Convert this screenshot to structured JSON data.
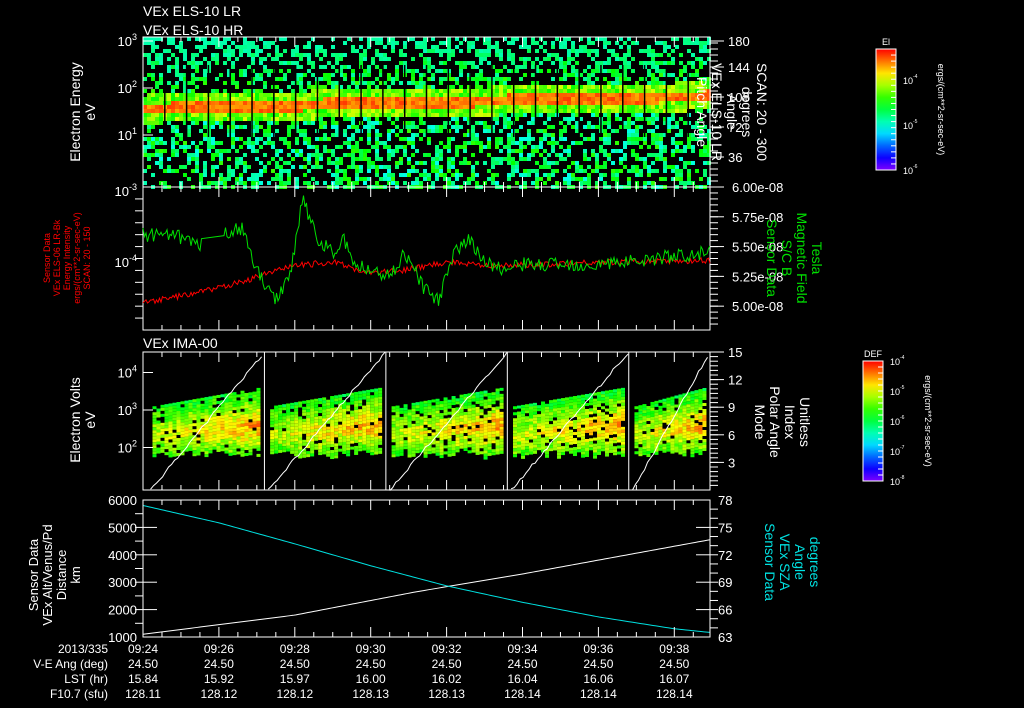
{
  "titles": {
    "p1_line1": "VEx ELS-10 LR",
    "p1_line2": "VEx ELS-10 HR",
    "p3": "VEx IMA-00"
  },
  "colors": {
    "background": "#000000",
    "axis": "#ffffff",
    "green": "#00e000",
    "red": "#ff0000",
    "cyan": "#00e0e0",
    "white": "#ffffff"
  },
  "chart_data": [
    {
      "type": "heatmap",
      "name": "ELS pitch-angle spectrogram",
      "ylabel": [
        "Electron Energy",
        "eV"
      ],
      "ylog": true,
      "ylim": [
        0.8,
        1000
      ],
      "yticks": [
        {
          "v": 1,
          "label": "10",
          "exp": "1"
        },
        {
          "v": 2,
          "label": "10",
          "exp": "2"
        },
        {
          "v": 3,
          "label": "10",
          "exp": "3"
        }
      ],
      "right_axis": {
        "label": [
          "Pitch Angle",
          "VEx ELS-10 LR",
          "Angle",
          "degrees",
          "SCAN: 20 - 300"
        ],
        "ticks": [
          "36",
          "72",
          "108",
          "144",
          "180"
        ],
        "ylim": [
          0,
          180
        ]
      },
      "scan_columns": 26,
      "peak_log_energy_by_minute": {
        "t": [
          0,
          3,
          6,
          9,
          12,
          15
        ],
        "v": [
          1.55,
          1.6,
          1.68,
          1.72,
          1.78,
          1.82
        ]
      },
      "colorbar": {
        "title": "El",
        "ticks": [
          {
            "label": "10",
            "exp": "-4"
          },
          {
            "label": "10",
            "exp": "-5"
          },
          {
            "label": "10",
            "exp": "-6"
          }
        ],
        "units": "ergs/(cm**2-sr-sec-eV)"
      }
    },
    {
      "type": "line",
      "name": "Energy intensity and magnetic field",
      "left_axis": {
        "label": [
          "Sensor Data",
          "VEx ELS-06 LR-Bk",
          "Energy Intensity",
          "ergs/(cm**2-sr-sec-eV)",
          "SCAN: 20 - 150"
        ],
        "ticks": [
          {
            "label": "10",
            "exp": "-3"
          },
          {
            "label": "10",
            "exp": "-4"
          }
        ],
        "ylim_log": [
          -4.9,
          -3
        ]
      },
      "right_axis": {
        "label": [
          "Sensor Data",
          "S/C B",
          "Magnetic Field",
          "Tesla"
        ],
        "ticks": [
          "5.00e-08",
          "5.25e-08",
          "5.50e-08",
          "5.75e-08",
          "6.00e-08"
        ],
        "ylim": [
          4.8e-08,
          6e-08
        ]
      },
      "series": [
        {
          "name": "Energy Intensity",
          "color": "#ff0000",
          "t_min": [
            0,
            1,
            2,
            3,
            4,
            5,
            6,
            7,
            8,
            9.5,
            12,
            14.94
          ],
          "log10_value": [
            -4.55,
            -4.45,
            -4.35,
            -4.2,
            -4.05,
            -4.0,
            -4.15,
            -4.1,
            -4.0,
            -4.05,
            -4.0,
            -3.98
          ]
        },
        {
          "name": "Magnetic Field",
          "color": "#00e000",
          "t_min": [
            0,
            1,
            1.5,
            2.2,
            2.6,
            3,
            3.5,
            3.9,
            4.2,
            4.6,
            5,
            5.3,
            5.6,
            6,
            6.5,
            6.9,
            7.4,
            7.8,
            8.2,
            8.6,
            9,
            9.5,
            10,
            12,
            14.94
          ],
          "value": [
            5.6e-08,
            5.58e-08,
            5.5e-08,
            5.62e-08,
            5.65e-08,
            5.3e-08,
            5.05e-08,
            5.3e-08,
            5.92e-08,
            5.55e-08,
            5.45e-08,
            5.55e-08,
            5.35e-08,
            5.3e-08,
            5.25e-08,
            5.45e-08,
            5.15e-08,
            5.05e-08,
            5.45e-08,
            5.55e-08,
            5.38e-08,
            5.3e-08,
            5.35e-08,
            5.35e-08,
            5.45e-08
          ]
        }
      ]
    },
    {
      "type": "heatmap",
      "name": "IMA ion spectrogram",
      "ylabel": [
        "Electron Volts",
        "eV"
      ],
      "ylog": true,
      "yticks": [
        {
          "v": 2,
          "label": "10",
          "exp": "2"
        },
        {
          "v": 3,
          "label": "10",
          "exp": "3"
        },
        {
          "v": 4,
          "label": "10",
          "exp": "4"
        }
      ],
      "right_axis": {
        "label": [
          "Mode",
          "Polar Angle",
          "Index",
          "Unitless"
        ],
        "ticks": [
          "3",
          "6",
          "9",
          "12",
          "15"
        ],
        "ylim": [
          0,
          15
        ]
      },
      "mode_change_minutes": [
        3.2,
        6.4,
        9.6,
        12.8
      ],
      "colorbar": {
        "title": "DEF",
        "ticks": [
          {
            "label": "10",
            "exp": "-4"
          },
          {
            "label": "10",
            "exp": "-5"
          },
          {
            "label": "10",
            "exp": "-6"
          },
          {
            "label": "10",
            "exp": "-7"
          },
          {
            "label": "10",
            "exp": "-8"
          }
        ],
        "units": "ergs/(cm**2-sr-sec-eV)"
      }
    },
    {
      "type": "line",
      "name": "Altitude and SZA",
      "left_axis": {
        "label": [
          "Sensor Data",
          "VEx Alt/Venus/Pd",
          "Distance",
          "km"
        ],
        "ticks": [
          "1000",
          "2000",
          "3000",
          "4000",
          "5000",
          "6000"
        ],
        "ylim": [
          1000,
          6000
        ]
      },
      "right_axis": {
        "label": [
          "Sensor Data",
          "VEx SZA",
          "Angle",
          "degrees"
        ],
        "ticks": [
          "63",
          "66",
          "69",
          "72",
          "75",
          "78"
        ],
        "ylim": [
          63,
          78
        ]
      },
      "series": [
        {
          "name": "Distance",
          "color": "#ffffff",
          "t_min": [
            0,
            4,
            7.2,
            10,
            14.94
          ],
          "value": [
            1100,
            1800,
            2650,
            3300,
            4550
          ]
        },
        {
          "name": "SZA",
          "color": "#00e0e0",
          "t_min": [
            0,
            2,
            4,
            6,
            8,
            10,
            12,
            14,
            14.94
          ],
          "value": [
            77.4,
            75.5,
            73.2,
            70.8,
            68.6,
            66.8,
            65.2,
            63.9,
            63.5
          ]
        }
      ]
    }
  ],
  "time_axis": {
    "row_labels": [
      "2013/335",
      "V-E Ang (deg)",
      "LST (hr)",
      "F10.7 (sfu)"
    ],
    "columns": [
      {
        "time": "09:24",
        "ve": "24.50",
        "lst": "15.84",
        "f107": "128.11"
      },
      {
        "time": "09:26",
        "ve": "24.50",
        "lst": "15.92",
        "f107": "128.12"
      },
      {
        "time": "09:28",
        "ve": "24.50",
        "lst": "15.97",
        "f107": "128.12"
      },
      {
        "time": "09:30",
        "ve": "24.50",
        "lst": "16.00",
        "f107": "128.13"
      },
      {
        "time": "09:32",
        "ve": "24.50",
        "lst": "16.02",
        "f107": "128.13"
      },
      {
        "time": "09:34",
        "ve": "24.50",
        "lst": "16.04",
        "f107": "128.14"
      },
      {
        "time": "09:36",
        "ve": "24.50",
        "lst": "16.06",
        "f107": "128.14"
      },
      {
        "time": "09:38",
        "ve": "24.50",
        "lst": "16.07",
        "f107": "128.14"
      }
    ]
  }
}
